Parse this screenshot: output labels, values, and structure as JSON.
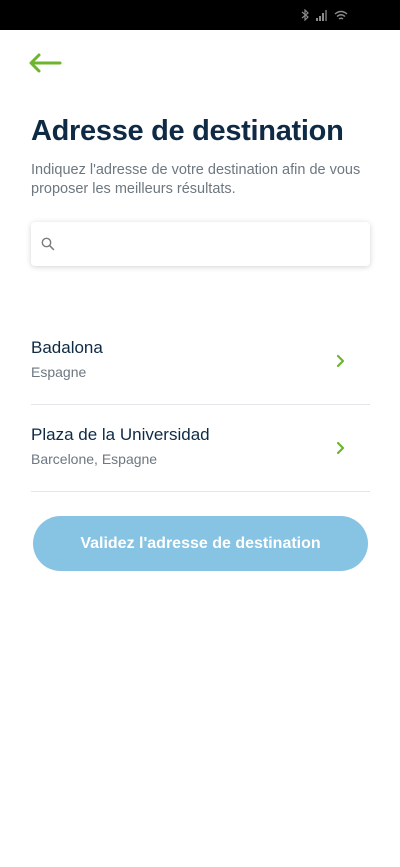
{
  "colors": {
    "accent": "#6cb52d",
    "title": "#0f2a44",
    "button": "#87c3e3"
  },
  "status_bar": {
    "icons": [
      "bluetooth-icon",
      "signal-icon",
      "wifi-icon"
    ]
  },
  "header": {
    "title": "Adresse de destination",
    "subtitle": "Indiquez l'adresse de votre destination afin de vous proposer les meilleurs résultats."
  },
  "search": {
    "value": "",
    "placeholder": ""
  },
  "results": [
    {
      "name": "Badalona",
      "detail": "Espagne"
    },
    {
      "name": "Plaza de la Universidad",
      "detail": "Barcelone, Espagne"
    }
  ],
  "validate_label": "Validez l'adresse de destination"
}
